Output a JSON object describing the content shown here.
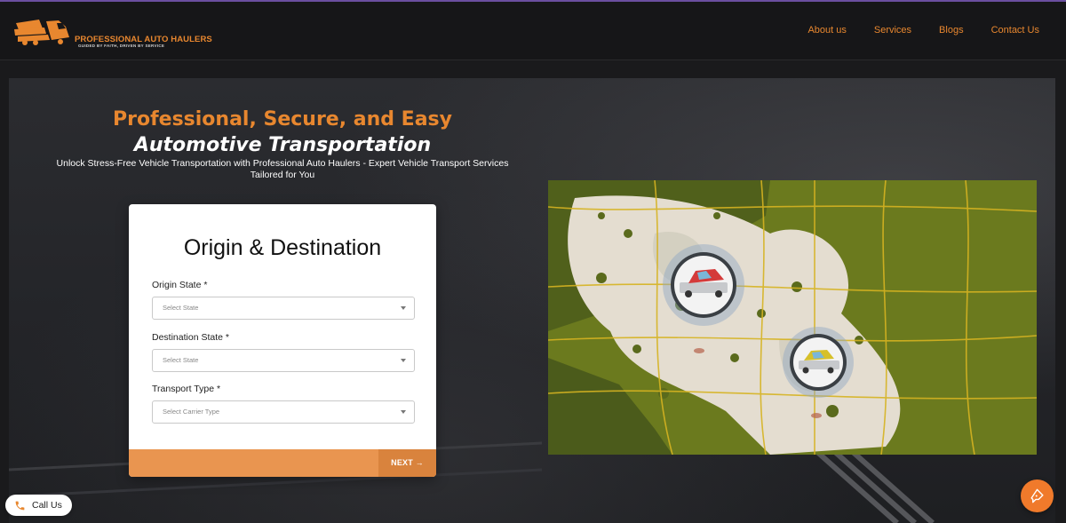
{
  "brand": {
    "name": "PROFESSIONAL AUTO HAULERS",
    "tagline": "GUIDED BY FAITH, DRIVEN BY SERVICE",
    "logo_icon": "truck-logo-icon"
  },
  "nav": {
    "items": [
      {
        "label": "About us"
      },
      {
        "label": "Services"
      },
      {
        "label": "Blogs"
      },
      {
        "label": "Contact Us"
      }
    ]
  },
  "hero": {
    "headline_1": "Professional, Secure, and Easy",
    "headline_2": "Automotive Transportation",
    "subtitle": "Unlock Stress-Free Vehicle Transportation with Professional Auto Haulers - Expert Vehicle Transport Services Tailored for You"
  },
  "form": {
    "title": "Origin & Destination",
    "origin": {
      "label": "Origin State *",
      "placeholder": "Select State"
    },
    "destination": {
      "label": "Destination State *",
      "placeholder": "Select State"
    },
    "transport": {
      "label": "Transport Type *",
      "placeholder": "Select Carrier Type"
    },
    "next_label": "NEXT"
  },
  "map": {
    "image": "route-map-illustration",
    "markers": [
      "red-car-marker-icon",
      "yellow-car-marker-icon"
    ]
  },
  "call_us": {
    "label": "Call Us",
    "icon": "phone-icon"
  },
  "chat": {
    "icon": "chat-support-icon"
  },
  "colors": {
    "accent": "#e8872f",
    "header_bg": "#161618",
    "form_footer": "#e99550",
    "next_button": "#d9833d",
    "chat_button": "#f07a2b"
  }
}
